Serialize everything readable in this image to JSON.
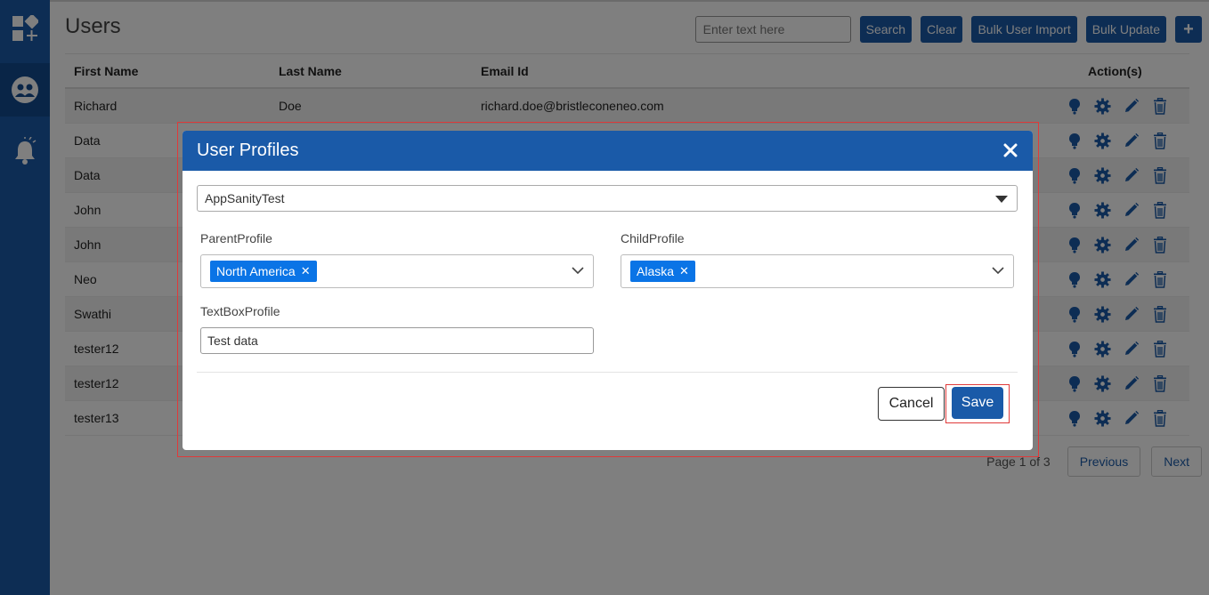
{
  "sidebar": {
    "items": [
      {
        "icon": "dashboard-add-icon"
      },
      {
        "icon": "users-icon",
        "active": true
      },
      {
        "icon": "notification-bell-icon"
      }
    ]
  },
  "page": {
    "title": "Users",
    "search": {
      "placeholder": "Enter text here",
      "value": ""
    },
    "buttons": {
      "search": "Search",
      "clear": "Clear",
      "bulk_import": "Bulk User Import",
      "bulk_update": "Bulk Update",
      "add": "+"
    }
  },
  "table": {
    "headers": {
      "first": "First Name",
      "last": "Last Name",
      "email": "Email Id",
      "actions": "Action(s)"
    },
    "rows": [
      {
        "first": "Richard",
        "last": "Doe",
        "email": "richard.doe@bristleconeneo.com"
      },
      {
        "first": "Data",
        "last": "",
        "email": ""
      },
      {
        "first": "Data",
        "last": "",
        "email": ""
      },
      {
        "first": "John",
        "last": "",
        "email": ""
      },
      {
        "first": "John",
        "last": "",
        "email": ""
      },
      {
        "first": "Neo",
        "last": "",
        "email": ""
      },
      {
        "first": "Swathi",
        "last": "",
        "email": ""
      },
      {
        "first": "tester12",
        "last": "",
        "email": ""
      },
      {
        "first": "tester12",
        "last": "",
        "email": ""
      },
      {
        "first": "tester13",
        "last": "",
        "email": ""
      }
    ]
  },
  "pagination": {
    "text": "Page 1 of 3",
    "previous": "Previous",
    "next": "Next"
  },
  "modal": {
    "title": "User Profiles",
    "app_select": {
      "value": "AppSanityTest"
    },
    "parent_profile": {
      "label": "ParentProfile",
      "chips": [
        "North America"
      ]
    },
    "child_profile": {
      "label": "ChildProfile",
      "chips": [
        "Alaska"
      ]
    },
    "textbox_profile": {
      "label": "TextBoxProfile",
      "value": "Test data"
    },
    "cancel": "Cancel",
    "save": "Save"
  },
  "colors": {
    "primary": "#1a5aa8",
    "chip": "#0a74e6",
    "highlight": "#e03a3a"
  }
}
